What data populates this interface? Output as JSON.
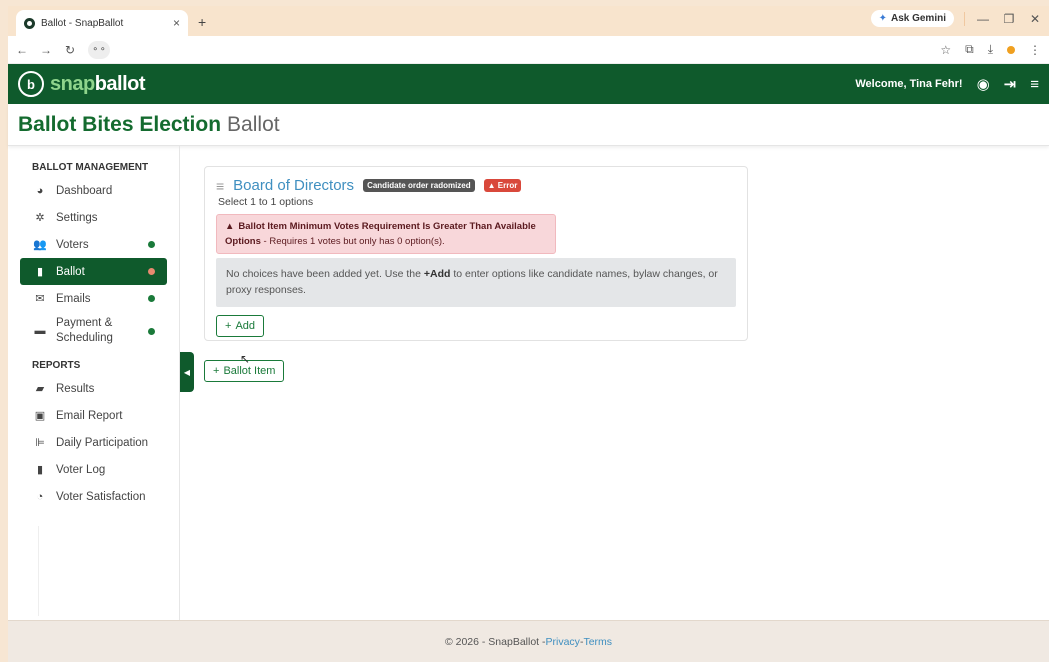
{
  "browser": {
    "tab_title": "Ballot - SnapBallot",
    "tab_close": "×",
    "new_tab": "+",
    "gemini_label": "Ask Gemini",
    "site_info": "⚬⚬"
  },
  "header": {
    "logo_prefix": "snap",
    "logo_suffix": "ballot",
    "welcome": "Welcome, Tina Fehr!"
  },
  "page": {
    "title_main": "Ballot Bites Election",
    "title_sub": "Ballot"
  },
  "sidebar": {
    "section_management": "BALLOT MANAGEMENT",
    "items": [
      {
        "label": "Dashboard",
        "icon": "dashboard-icon"
      },
      {
        "label": "Settings",
        "icon": "gear-icon"
      },
      {
        "label": "Voters",
        "icon": "users-icon",
        "status": "green"
      },
      {
        "label": "Ballot",
        "icon": "clipboard-icon",
        "status": "red",
        "active": true
      },
      {
        "label": "Emails",
        "icon": "envelope-icon",
        "status": "green"
      },
      {
        "label": "Payment & Scheduling",
        "icon": "credit-card-icon",
        "status": "green"
      }
    ],
    "section_reports": "REPORTS",
    "reports": [
      {
        "label": "Results",
        "icon": "results-icon"
      },
      {
        "label": "Email Report",
        "icon": "email-report-icon"
      },
      {
        "label": "Daily Participation",
        "icon": "chart-icon"
      },
      {
        "label": "Voter Log",
        "icon": "log-icon"
      },
      {
        "label": "Voter Satisfaction",
        "icon": "pie-icon"
      }
    ]
  },
  "ballot_item": {
    "title": "Board of Directors",
    "badge_order": "Candidate order radomized",
    "badge_error": "Error",
    "subtitle": "Select 1 to 1 options",
    "alert_title": "Ballot Item Minimum Votes Requirement Is Greater Than Available",
    "alert_label": "Options",
    "alert_text": " - Requires 1 votes but only has 0 option(s).",
    "info_pre": "No choices have been added yet. Use the ",
    "info_bold": "+Add",
    "info_post": " to enter options like candidate names, bylaw changes, or proxy responses.",
    "add_label": "Add"
  },
  "ballot_item_button": "Ballot Item",
  "footer": {
    "copyright": "© 2026 - SnapBallot - ",
    "privacy": "Privacy",
    "sep": " - ",
    "terms": "Terms"
  },
  "colors": {
    "brand_green": "#0f5a2c",
    "accent_blue": "#3f8fc0",
    "error_red": "#d9483b"
  }
}
